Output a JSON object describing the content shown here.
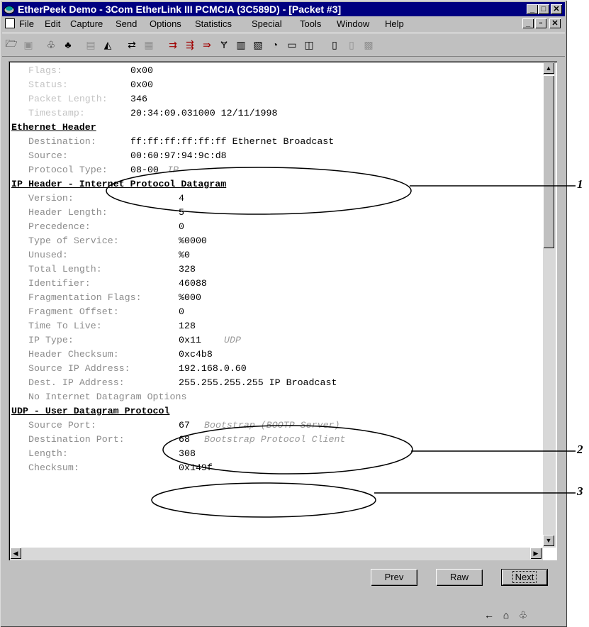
{
  "window": {
    "title": "EtherPeek Demo - 3Com EtherLink III PCMCIA (3C589D) - [Packet #3]",
    "controls": [
      "minimize",
      "maximize",
      "close"
    ]
  },
  "menubar": {
    "items": [
      "File",
      "Edit",
      "Capture",
      "Send",
      "Options",
      "Statistics",
      "Special",
      "Tools",
      "Window",
      "Help"
    ]
  },
  "toolbar": {
    "icons": [
      "open-icon",
      "save-icon",
      "start-capture-icon",
      "stop-capture-icon",
      "packets-icon",
      "filter-icon",
      "node-icon",
      "protocol-icon",
      "send-icon",
      "send-once-icon",
      "send-repeat-icon",
      "trigger-icon",
      "net-stats-icon",
      "net-stats2-icon",
      "monitor-icon",
      "history-icon",
      "size-icon",
      "doc-icon",
      "doc2-icon",
      "doc3-icon"
    ]
  },
  "decode": {
    "header_rows": [
      {
        "label": "Flags:",
        "value": "0x00"
      },
      {
        "label": "Status:",
        "value": "0x00"
      },
      {
        "label": "Packet Length:",
        "value": "346"
      },
      {
        "label": "Timestamp:",
        "value": "20:34:09.031000 12/11/1998"
      }
    ],
    "sections": [
      {
        "title": "Ethernet Header",
        "rows": [
          {
            "label": "Destination:",
            "value": "ff:ff:ff:ff:ff:ff Ethernet Broadcast",
            "note": ""
          },
          {
            "label": "Source:",
            "value": "00:60:97:94:9c:d8",
            "note": ""
          },
          {
            "label": "Protocol Type:",
            "value": "08-00",
            "note": "IP"
          }
        ]
      },
      {
        "title": "IP Header - Internet Protocol Datagram",
        "rows": [
          {
            "label": "Version:",
            "value": "4",
            "note": ""
          },
          {
            "label": "Header Length:",
            "value": "5",
            "note": ""
          },
          {
            "label": "Precedence:",
            "value": "0",
            "note": ""
          },
          {
            "label": "Type of Service:",
            "value": "%0000",
            "note": ""
          },
          {
            "label": "Unused:",
            "value": "%0",
            "note": ""
          },
          {
            "label": "Total Length:",
            "value": "328",
            "note": ""
          },
          {
            "label": "Identifier:",
            "value": "46088",
            "note": ""
          },
          {
            "label": "Fragmentation Flags:",
            "value": "%000",
            "note": ""
          },
          {
            "label": "Fragment Offset:",
            "value": "0",
            "note": ""
          },
          {
            "label": "Time To Live:",
            "value": "128",
            "note": ""
          },
          {
            "label": "IP Type:",
            "value": "0x11",
            "note": "UDP"
          },
          {
            "label": "Header Checksum:",
            "value": "0xc4b8",
            "note": ""
          },
          {
            "label": "Source IP Address:",
            "value": "192.168.0.60",
            "note": ""
          },
          {
            "label": "Dest. IP Address:",
            "value": "255.255.255.255 IP Broadcast",
            "note": ""
          },
          {
            "label": "No Internet Datagram Options",
            "value": "",
            "note": ""
          }
        ]
      },
      {
        "title": "UDP - User Datagram Protocol",
        "rows": [
          {
            "label": "Source Port:",
            "value": "67",
            "note": "Bootstrap (BOOTP Server)"
          },
          {
            "label": "Destination Port:",
            "value": "68",
            "note": "Bootstrap Protocol Client"
          },
          {
            "label": "Length:",
            "value": "308",
            "note": ""
          },
          {
            "label": "Checksum:",
            "value": "0x149f",
            "note": ""
          }
        ]
      }
    ]
  },
  "buttons": {
    "prev": "Prev",
    "raw": "Raw",
    "next": "Next"
  },
  "annotations": [
    "1",
    "2",
    "3"
  ]
}
